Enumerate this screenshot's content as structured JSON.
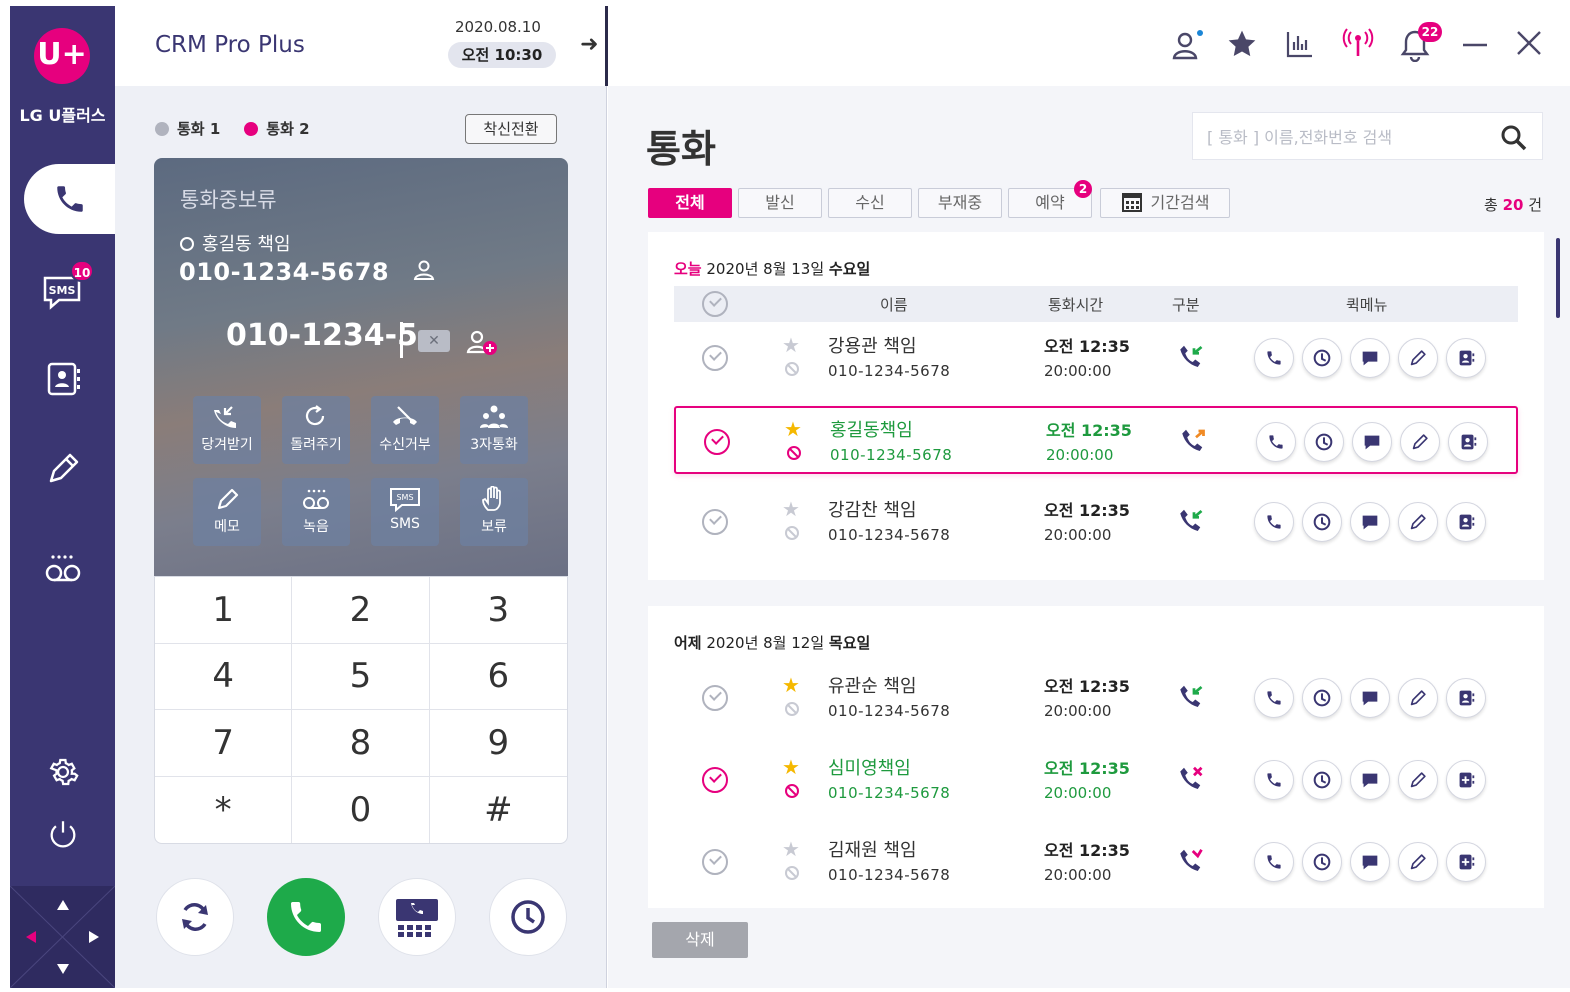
{
  "brand": "LG U플러스",
  "logo_text": "U+",
  "nav": {
    "sms_label": "SMS",
    "sms_badge": "10"
  },
  "dialer": {
    "title": "CRM Pro Plus",
    "date": "2020.08.10",
    "time": "오전 10:30",
    "line1": "통화 1",
    "line2": "통화 2",
    "line1_color": "#b0b3be",
    "line2_color": "#e6007e",
    "switch_label": "착신전환",
    "status": "통화중보류",
    "caller_name": "홍길동 책임",
    "caller_number": "010-1234-5678",
    "dial_input": "010-1234-5",
    "actions": [
      "당겨받기",
      "돌려주기",
      "수신거부",
      "3자통화",
      "메모",
      "녹음",
      "SMS",
      "보류"
    ],
    "keys": [
      "1",
      "2",
      "3",
      "4",
      "5",
      "6",
      "7",
      "8",
      "9",
      "*",
      "0",
      "#"
    ]
  },
  "topbar": {
    "bell_badge": "22"
  },
  "main": {
    "title": "통화",
    "search_placeholder": "[ 통화 ] 이름,전화번호 검색",
    "tabs": [
      "전체",
      "발신",
      "수신",
      "부재중",
      "예약"
    ],
    "period_tab": "기간검색",
    "reservation_badge": "2",
    "total_prefix": "총",
    "total_count": "20",
    "total_suffix": "건",
    "columns": {
      "name": "이름",
      "time": "통화시간",
      "type": "구분",
      "quick": "퀵메뉴"
    },
    "delete_label": "삭제"
  },
  "groups": [
    {
      "label": "오늘",
      "date": "2020년 8월 13일",
      "weekday": "수요일",
      "rows": [
        {
          "name": "강용관 책임",
          "phone": "010-1234-5678",
          "time": "오전 12:35",
          "duration": "20:00:00",
          "starred": false,
          "blocked": false,
          "selected": false,
          "type": "incoming"
        },
        {
          "name": "홍길동책임",
          "phone": "010-1234-5678",
          "time": "오전 12:35",
          "duration": "20:00:00",
          "starred": true,
          "blocked": true,
          "selected": true,
          "type": "outgoing"
        },
        {
          "name": "강감찬 책임",
          "phone": "010-1234-5678",
          "time": "오전 12:35",
          "duration": "20:00:00",
          "starred": false,
          "blocked": false,
          "selected": false,
          "type": "incoming"
        }
      ]
    },
    {
      "label": "어제",
      "date": "2020년 8월 12일",
      "weekday": "목요일",
      "rows": [
        {
          "name": "유관순 책임",
          "phone": "010-1234-5678",
          "time": "오전 12:35",
          "duration": "20:00:00",
          "starred": true,
          "blocked": false,
          "selected": false,
          "type": "incoming"
        },
        {
          "name": "심미영책임",
          "phone": "010-1234-5678",
          "time": "오전 12:35",
          "duration": "20:00:00",
          "starred": true,
          "blocked": true,
          "selected": true,
          "type": "missed"
        },
        {
          "name": "김재원 책임",
          "phone": "010-1234-5678",
          "time": "오전 12:35",
          "duration": "20:00:00",
          "starred": false,
          "blocked": false,
          "selected": false,
          "type": "rejected"
        }
      ]
    }
  ],
  "colors": {
    "accent": "#e6007e",
    "nav": "#3a3672",
    "call_green": "#1eaa4a"
  }
}
